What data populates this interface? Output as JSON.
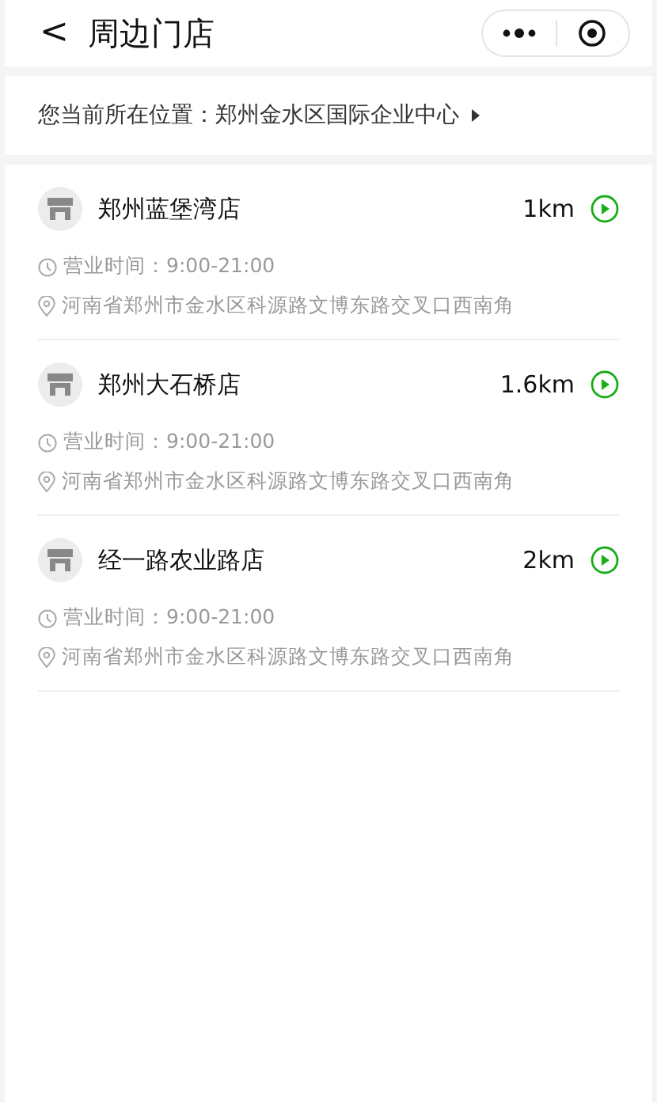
{
  "nav": {
    "back": "<",
    "title": "周边门店"
  },
  "location": {
    "label": "您当前所在位置：",
    "place": "郑州金水区国际企业中心"
  },
  "stores": [
    {
      "name": "郑州蓝堡湾店",
      "distance": "1km",
      "hours": "营业时间：9:00-21:00",
      "address": "河南省郑州市金水区科源路文博东路交叉口西南角"
    },
    {
      "name": "郑州大石桥店",
      "distance": "1.6km",
      "hours": "营业时间：9:00-21:00",
      "address": "河南省郑州市金水区科源路文博东路交叉口西南角"
    },
    {
      "name": "经一路农业路店",
      "distance": "2km",
      "hours": "营业时间：9:00-21:00",
      "address": "河南省郑州市金水区科源路文博东路交叉口西南角"
    }
  ]
}
